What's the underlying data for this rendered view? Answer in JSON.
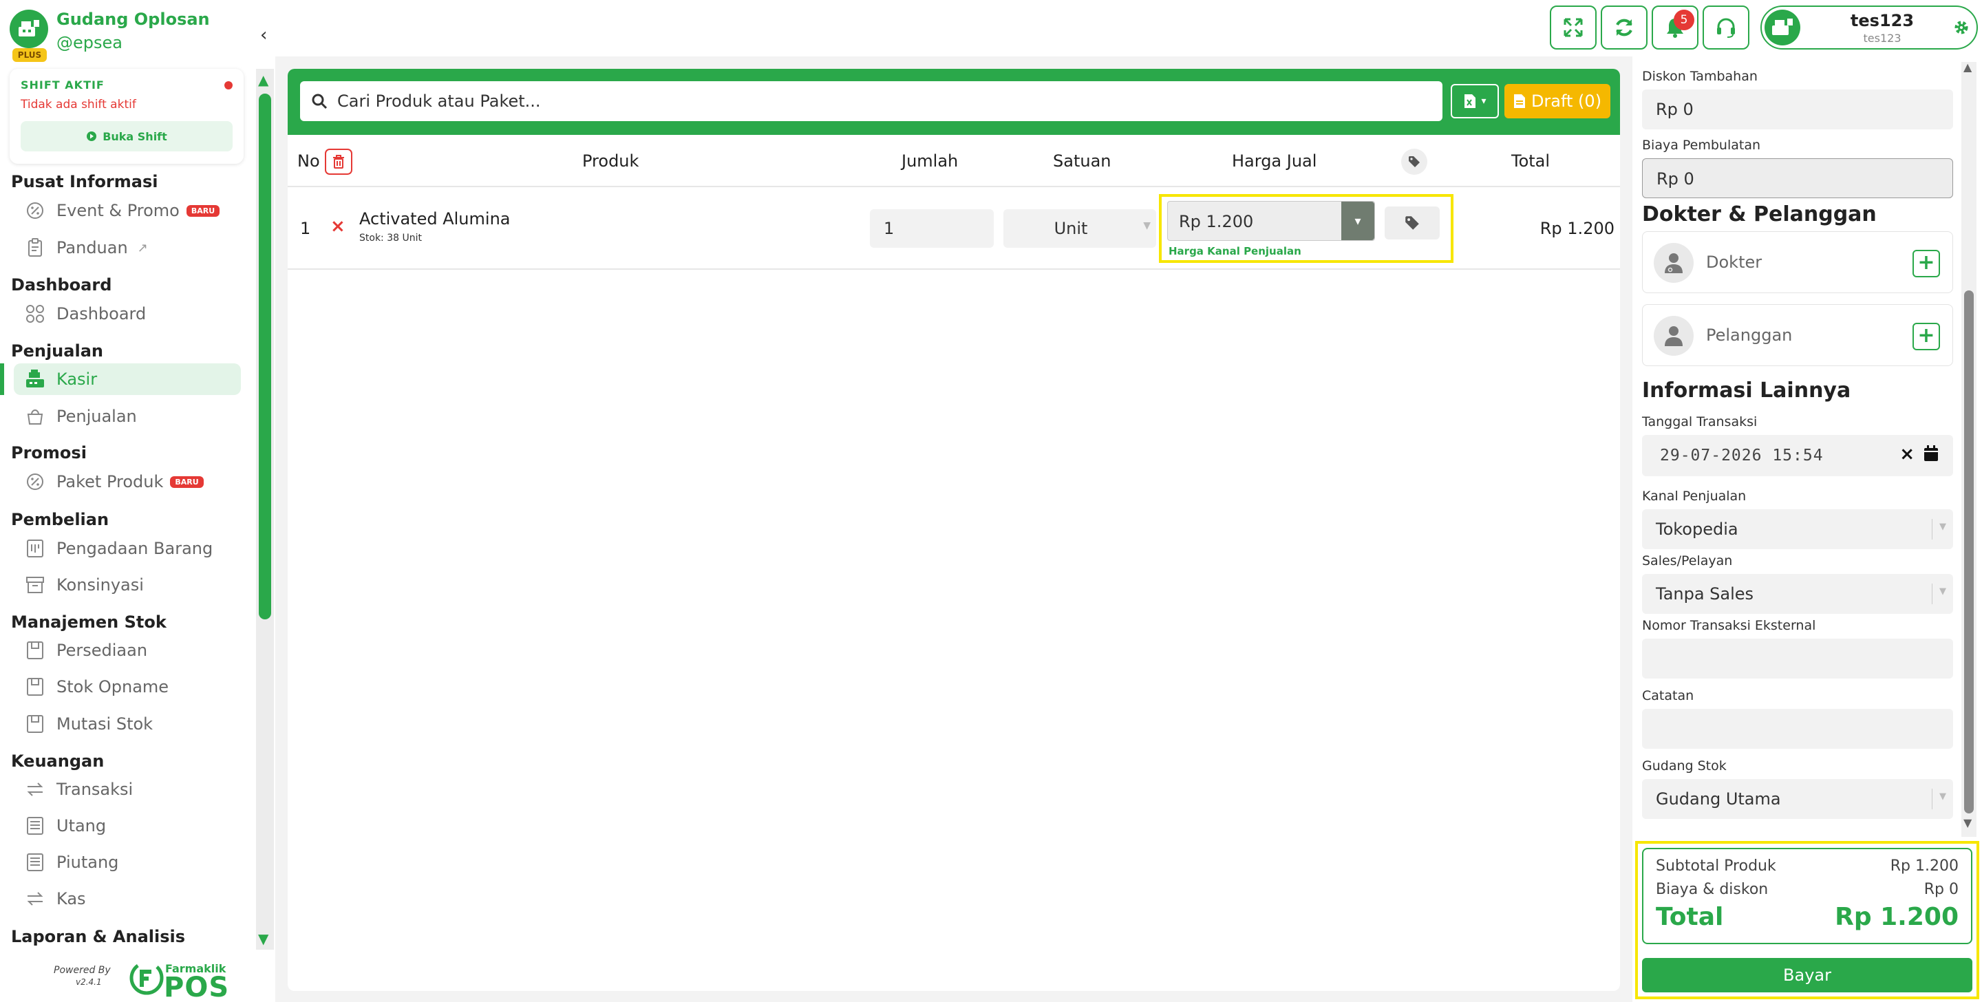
{
  "brand": {
    "name": "Gudang Oplosan",
    "handle": "@epsea",
    "badge": "PLUS"
  },
  "shift": {
    "title": "SHIFT AKTIF",
    "status": "Tidak ada shift aktif",
    "button": "Buka Shift"
  },
  "sidebar": {
    "sections": [
      {
        "head": "Pusat Informasi",
        "items": [
          {
            "label": "Event & Promo",
            "icon": "percent-icon",
            "badge": "BARU"
          },
          {
            "label": "Panduan",
            "icon": "clipboard-icon",
            "external": true
          }
        ]
      },
      {
        "head": "Dashboard",
        "items": [
          {
            "label": "Dashboard",
            "icon": "grid-icon"
          }
        ]
      },
      {
        "head": "Penjualan",
        "items": [
          {
            "label": "Kasir",
            "icon": "cash-register-icon",
            "active": true
          },
          {
            "label": "Penjualan",
            "icon": "basket-icon"
          }
        ]
      },
      {
        "head": "Promosi",
        "items": [
          {
            "label": "Paket Produk",
            "icon": "percent-icon",
            "badge": "BARU"
          }
        ]
      },
      {
        "head": "Pembelian",
        "items": [
          {
            "label": "Pengadaan Barang",
            "icon": "procurement-icon"
          },
          {
            "label": "Konsinyasi",
            "icon": "archive-icon"
          }
        ]
      },
      {
        "head": "Manajemen Stok",
        "items": [
          {
            "label": "Persediaan",
            "icon": "box-icon"
          },
          {
            "label": "Stok Opname",
            "icon": "box-icon"
          },
          {
            "label": "Mutasi Stok",
            "icon": "box-icon"
          }
        ]
      },
      {
        "head": "Keuangan",
        "items": [
          {
            "label": "Transaksi",
            "icon": "exchange-icon"
          },
          {
            "label": "Utang",
            "icon": "ledger-icon"
          },
          {
            "label": "Piutang",
            "icon": "ledger-icon"
          },
          {
            "label": "Kas",
            "icon": "exchange-icon"
          }
        ]
      },
      {
        "head": "Laporan & Analisis",
        "items": []
      }
    ],
    "powered_by": "Powered By",
    "version": "v2.4.1",
    "logo_top": "Farmaklik",
    "logo_pos": "POS"
  },
  "topbar": {
    "notification_count": "5",
    "user_name": "tes123",
    "user_sub": "tes123"
  },
  "search": {
    "placeholder": "Cari Produk atau Paket...",
    "draft_label": "Draft (0)"
  },
  "table": {
    "headers": {
      "no": "No",
      "product": "Produk",
      "qty": "Jumlah",
      "unit": "Satuan",
      "price": "Harga Jual",
      "total": "Total"
    },
    "rows": [
      {
        "no": "1",
        "name": "Activated Alumina",
        "stock": "Stok: 38 Unit",
        "qty": "1",
        "unit": "Unit",
        "price": "Rp 1.200",
        "price_hint": "Harga Kanal Penjualan",
        "total": "Rp 1.200"
      }
    ]
  },
  "right": {
    "discount_label": "Diskon Tambahan",
    "discount_value": "Rp 0",
    "rounding_label": "Biaya Pembulatan",
    "rounding_value": "Rp 0",
    "doctor_head": "Dokter & Pelanggan",
    "doctor": "Dokter",
    "customer": "Pelanggan",
    "info_head": "Informasi Lainnya",
    "date_label": "Tanggal Transaksi",
    "date_value": "29-07-2026 15:54",
    "channel_label": "Kanal Penjualan",
    "channel_value": "Tokopedia",
    "sales_label": "Sales/Pelayan",
    "sales_value": "Tanpa Sales",
    "ext_label": "Nomor Transaksi Eksternal",
    "ext_value": "",
    "note_label": "Catatan",
    "note_value": "",
    "warehouse_label": "Gudang Stok",
    "warehouse_value": "Gudang Utama"
  },
  "summary": {
    "subtotal_label": "Subtotal Produk",
    "subtotal_value": "Rp 1.200",
    "fees_label": "Biaya & diskon",
    "fees_value": "Rp 0",
    "total_label": "Total",
    "total_value": "Rp 1.200",
    "pay_label": "Bayar"
  },
  "colors": {
    "primary": "#2aa84a",
    "danger": "#e53935",
    "draft": "#f5b800",
    "highlight": "#f7e600"
  }
}
